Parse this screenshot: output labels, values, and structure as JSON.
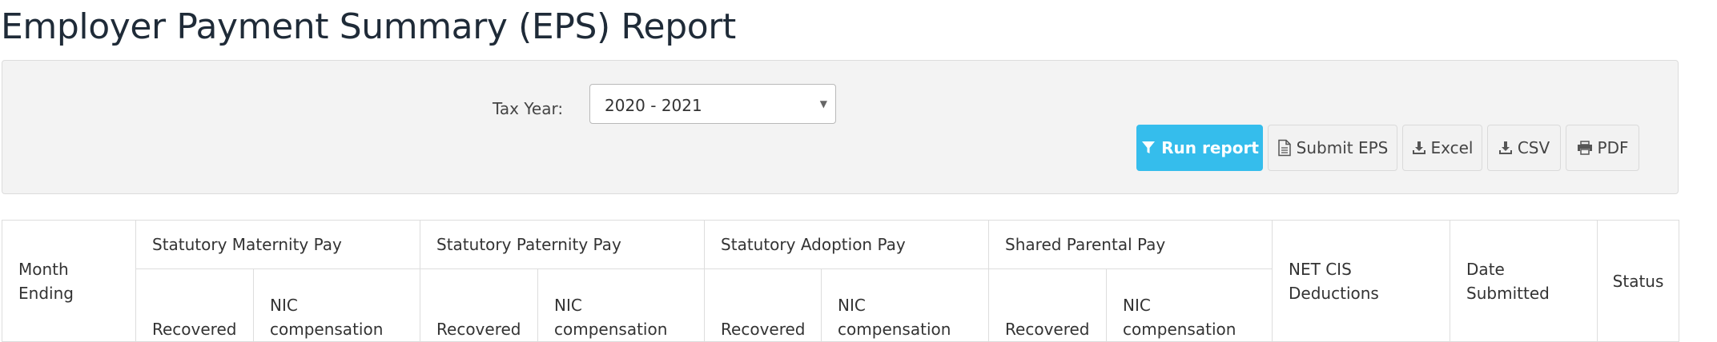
{
  "page": {
    "title": "Employer Payment Summary (EPS) Report"
  },
  "filters": {
    "tax_year_label": "Tax Year:",
    "tax_year_value": "2020 - 2021"
  },
  "toolbar": {
    "run_label": "Run report",
    "submit_label": "Submit EPS",
    "excel_label": "Excel",
    "csv_label": "CSV",
    "pdf_label": "PDF"
  },
  "table": {
    "month_ending_line1": "Month",
    "month_ending_line2": "Ending",
    "groups": [
      "Statutory Maternity Pay",
      "Statutory Paternity Pay",
      "Statutory Adoption Pay",
      "Shared Parental Pay"
    ],
    "recovered": "Recovered",
    "nic_line1": "NIC",
    "nic_line2": "compensation",
    "net_cis_line1": "NET CIS",
    "net_cis_line2": "Deductions",
    "date_line1": "Date",
    "date_line2": "Submitted",
    "status": "Status"
  },
  "colors": {
    "accent": "#35bdec",
    "panel": "#f3f3f3",
    "title": "#1f2b38"
  },
  "icons": {
    "run": "funnel-icon",
    "submit": "document-icon",
    "excel": "download-icon",
    "csv": "download-icon",
    "pdf": "printer-icon",
    "select": "caret-down-icon"
  }
}
